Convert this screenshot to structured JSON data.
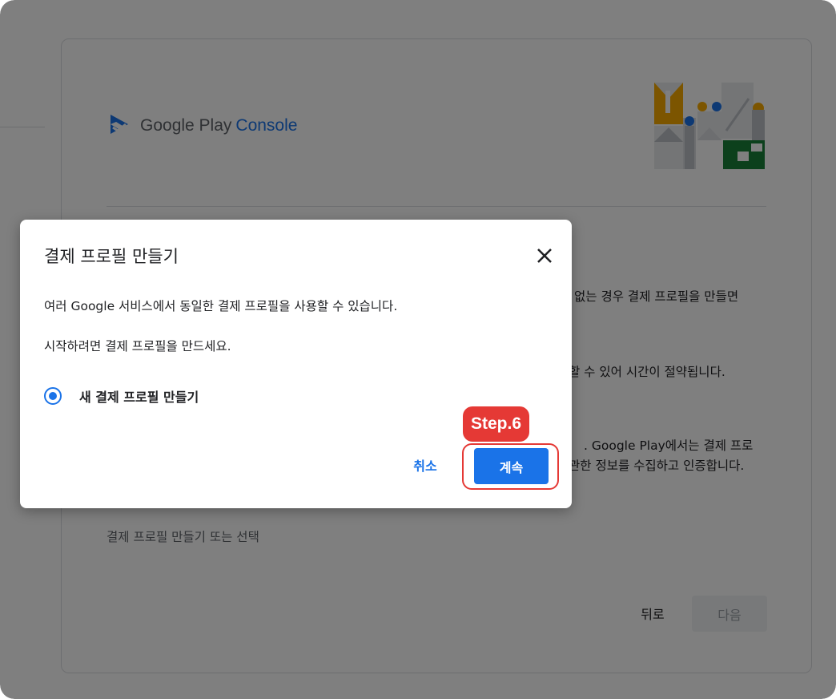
{
  "background": {
    "logo": {
      "google": "Google Play",
      "console": "Console"
    },
    "text_lines": [
      "없는 경우 결제 프로필을 만들면",
      "할 수 있어 시간이 절약됩니다.",
      ". Google Play에서는 결제 프로",
      "관한 정보를 수집하고 인증합니다."
    ],
    "link_text": "결제 프로필 만들기 또는 선택",
    "back_label": "뒤로",
    "next_label": "다음"
  },
  "dialog": {
    "title": "결제 프로필 만들기",
    "body_1": "여러 Google 서비스에서 동일한 결제 프로필을 사용할 수 있습니다.",
    "body_2": "시작하려면 결제 프로필을 만드세요.",
    "radio_label": "새 결제 프로필 만들기",
    "cancel_label": "취소",
    "continue_label": "계속"
  },
  "annotation": {
    "step_label": "Step.6"
  },
  "colors": {
    "accent": "#1a73e8",
    "highlight": "#e53935",
    "overlay": "rgba(0,0,0,0.5)"
  },
  "icons": {
    "close": "close-icon",
    "logo": "play-console-logo-icon",
    "radio": "radio-selected-icon"
  }
}
